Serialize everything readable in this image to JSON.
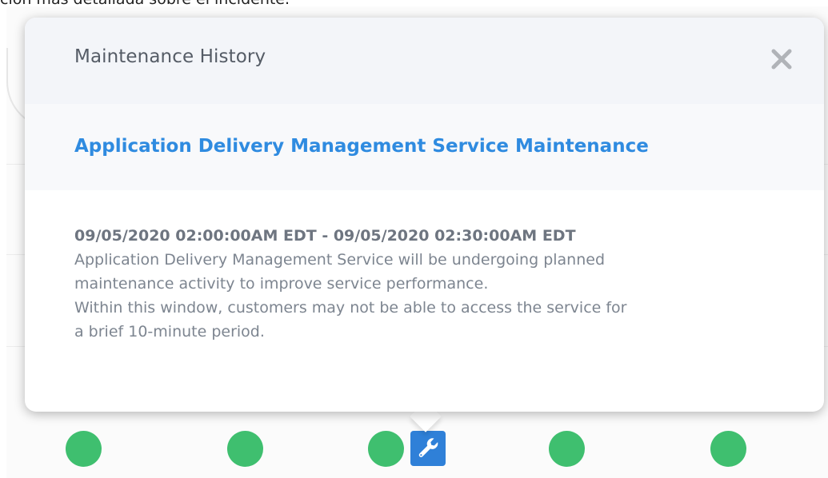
{
  "background": {
    "top_text": "ción más detallada sobre el incidente."
  },
  "popover": {
    "title": "Maintenance History",
    "close_icon": "close-icon",
    "incident_title": "Application Delivery Management Service Maintenance",
    "time_range": "09/05/2020 02:00:00AM EDT - 09/05/2020 02:30:00AM EDT",
    "description_lines": [
      "Application Delivery Management Service will be undergoing planned",
      "maintenance activity to improve service performance.",
      "Within this window, customers may not be able to access the service for",
      "a brief 10-minute period."
    ]
  },
  "status_row": {
    "items": [
      {
        "type": "operational",
        "icon": "status-dot"
      },
      {
        "type": "operational",
        "icon": "status-dot"
      },
      {
        "type": "operational",
        "icon": "status-dot"
      },
      {
        "type": "maintenance",
        "icon": "wrench-icon"
      },
      {
        "type": "operational",
        "icon": "status-dot"
      },
      {
        "type": "operational",
        "icon": "status-dot"
      }
    ]
  },
  "colors": {
    "accent": "#2f8be0",
    "operational": "#3fbf6f",
    "maintenance": "#2f80d8",
    "text_muted": "#7d8590"
  }
}
